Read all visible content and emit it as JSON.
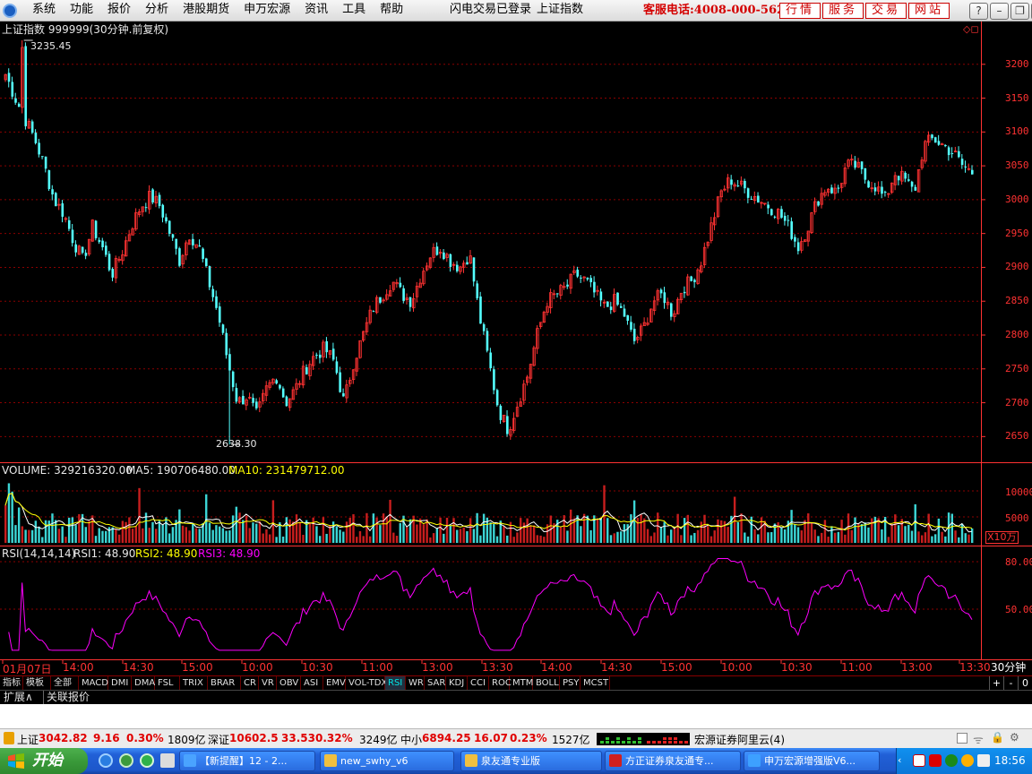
{
  "menubar": {
    "items": [
      "系统",
      "功能",
      "报价",
      "分析",
      "港股期货",
      "申万宏源",
      "资讯",
      "工具",
      "帮助"
    ],
    "status_text": "闪电交易已登录",
    "index_text": "上证指数",
    "hotline": "客服电话:4008-000-562",
    "quick_buttons": [
      "行情",
      "服务",
      "交易",
      "网站"
    ]
  },
  "chart": {
    "title": "上证指数 999999(30分钟.前复权)",
    "high_label": "3235.45",
    "low_label": "2638.30",
    "price_axis": [
      "3200",
      "3150",
      "3100",
      "3050",
      "3000",
      "2950",
      "2900",
      "2850",
      "2800",
      "2750",
      "2700",
      "2650"
    ],
    "volume_header": {
      "label": "VOLUME: 329216320.00",
      "ma5": "MA5: 190706480.00",
      "ma10": "MA10: 231479712.00"
    },
    "volume_axis": [
      "10000",
      "5000"
    ],
    "volume_unit": "X10万",
    "rsi_header": {
      "params": "RSI(14,14,14)",
      "rsi1": "RSI1: 48.90",
      "rsi2": "RSI2: 48.90",
      "rsi3": "RSI3: 48.90"
    },
    "rsi_axis": [
      "80.00",
      "50.00"
    ],
    "time_axis": [
      "01月07日",
      "14:00",
      "14:30",
      "15:00",
      "10:00",
      "10:30",
      "11:00",
      "13:00",
      "13:30",
      "14:00",
      "14:30",
      "15:00",
      "10:00",
      "10:30",
      "11:00",
      "13:00",
      "13:30"
    ],
    "period": "30分钟",
    "colors": {
      "up": "#ff3232",
      "down": "#54ffff",
      "ma5": "#ffffff",
      "ma10": "#ffff00",
      "rsi": "#ff00ff",
      "grid": "#8b0000"
    }
  },
  "chart_data": {
    "type": "candlestick",
    "title": "上证指数 999999(30分钟.前复权)",
    "close_approx": [
      3185,
      3150,
      3120,
      3090,
      3050,
      3000,
      2980,
      2940,
      2910,
      2960,
      2930,
      2890,
      2920,
      2960,
      2990,
      3005,
      2990,
      2950,
      2910,
      2950,
      2930,
      2880,
      2830,
      2760,
      2700,
      2710,
      2680,
      2720,
      2740,
      2700,
      2720,
      2750,
      2770,
      2780,
      2760,
      2700,
      2760,
      2800,
      2840,
      2860,
      2880,
      2860,
      2850,
      2890,
      2920,
      2930,
      2910,
      2900,
      2920,
      2830,
      2760,
      2690,
      2660,
      2700,
      2740,
      2800,
      2850,
      2860,
      2870,
      2890,
      2880,
      2860,
      2840,
      2850,
      2830,
      2790,
      2810,
      2850,
      2860,
      2830,
      2870,
      2880,
      2910,
      2960,
      3010,
      3030,
      3020,
      3010,
      3000,
      2990,
      2980,
      2960,
      2930,
      2960,
      3000,
      3020,
      3010,
      3050,
      3050,
      3030,
      3020,
      3000,
      3040,
      3030,
      3010,
      3080,
      3090,
      3080,
      3070,
      3050,
      3040
    ],
    "ylim": [
      2620,
      3250
    ],
    "high": 3235.45,
    "low": 2638.3,
    "volume": {
      "latest": 329216320.0,
      "ma5": 190706480.0,
      "ma10": 231479712.0,
      "unit": "X10万"
    },
    "rsi": {
      "rsi1": 48.9,
      "rsi2": 48.9,
      "rsi3": 48.9,
      "axis_ticks": [
        80,
        50
      ]
    }
  },
  "tabs": {
    "items": [
      "指标",
      "模板",
      "全部",
      "MACD",
      "DMI",
      "DMA",
      "FSL",
      "TRIX",
      "BRAR",
      "CR",
      "VR",
      "OBV",
      "ASI",
      "EMV",
      "VOL-TDX",
      "RSI",
      "WR",
      "SAR",
      "KDJ",
      "CCI",
      "ROC",
      "MTM",
      "BOLL",
      "PSY",
      "MCST"
    ],
    "active": "RSI",
    "controls": [
      "+",
      "-",
      "0"
    ]
  },
  "extbar": {
    "items": [
      "扩展∧",
      "关联报价"
    ]
  },
  "ticker": {
    "sh_label": "上证",
    "sh_value": "3042.82",
    "sh_change": "9.16",
    "sh_pct": "0.30%",
    "sh_amount": "1809亿",
    "sz_label": "深证",
    "sz_value": "10602.5",
    "sz_change": "33.53",
    "sz_pct": "0.32%",
    "sz_amount": "3249亿",
    "zx_label": "中小",
    "zx_value": "6894.25",
    "zx_change": "16.07",
    "zx_pct": "0.23%",
    "zx_amount": "1527亿",
    "broker": "宏源证券阿里云(4)"
  },
  "taskbar": {
    "start": "开始",
    "tasks": [
      "【新提醒】12 - 2...",
      "new_swhy_v6",
      "泉友通专业版",
      "方正证券泉友通专...",
      "申万宏源增强版V6..."
    ],
    "clock": "18:56"
  }
}
